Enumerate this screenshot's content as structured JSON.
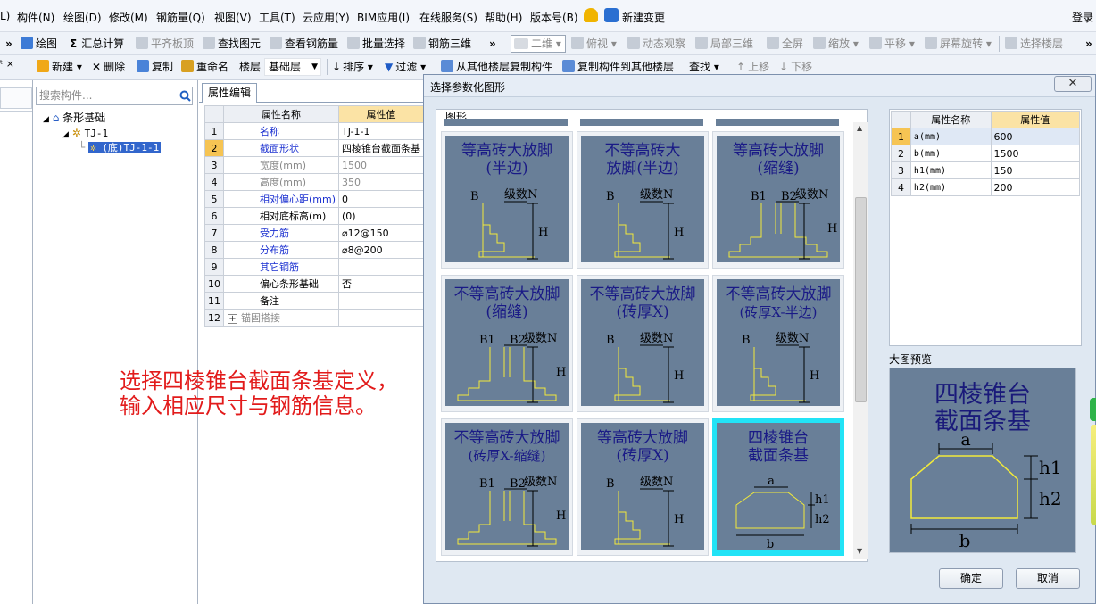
{
  "menubar": {
    "items": [
      "L)",
      "构件(N)",
      "绘图(D)",
      "修改(M)",
      "钢筋量(Q)",
      "视图(V)",
      "工具(T)",
      "云应用(Y)",
      "BIM应用(I)",
      "在线服务(S)",
      "帮助(H)",
      "版本号(B)",
      "新建变更"
    ],
    "login": "登录"
  },
  "toolbar1": {
    "items": [
      "绘图",
      "汇总计算",
      "平齐板顶",
      "查找图元",
      "查看钢筋量",
      "批量选择",
      "钢筋三维",
      "二维",
      "俯视",
      "动态观察",
      "局部三维",
      "全屏",
      "缩放",
      "平移",
      "屏幕旋转",
      "选择楼层"
    ]
  },
  "toolbar2": {
    "items": [
      "新建",
      "删除",
      "复制",
      "重命名",
      "楼层",
      "基础层",
      "排序",
      "过滤",
      "从其他楼层复制构件",
      "复制构件到其他楼层",
      "查找",
      "上移",
      "下移"
    ]
  },
  "tree": {
    "search_placeholder": "搜索构件...",
    "root": "条形基础",
    "child": "TJ-1",
    "leaf": "(底)TJ-1-1"
  },
  "properties": {
    "tab": "属性编辑",
    "col_name": "属性名称",
    "col_value": "属性值",
    "rows": [
      {
        "n": "1",
        "name": "名称",
        "value": "TJ-1-1"
      },
      {
        "n": "2",
        "name": "截面形状",
        "value": "四棱锥台截面条基"
      },
      {
        "n": "3",
        "name": "宽度(mm)",
        "value": "1500"
      },
      {
        "n": "4",
        "name": "高度(mm)",
        "value": "350"
      },
      {
        "n": "5",
        "name": "相对偏心距(mm)",
        "value": "0"
      },
      {
        "n": "6",
        "name": "相对底标高(m)",
        "value": "(0)"
      },
      {
        "n": "7",
        "name": "受力筋",
        "value": "⌀12@150"
      },
      {
        "n": "8",
        "name": "分布筋",
        "value": "⌀8@200"
      },
      {
        "n": "9",
        "name": "其它钢筋",
        "value": ""
      },
      {
        "n": "10",
        "name": "偏心条形基础",
        "value": "否"
      },
      {
        "n": "11",
        "name": "备注",
        "value": ""
      },
      {
        "n": "12",
        "name": "锚固搭接",
        "value": ""
      }
    ]
  },
  "annotation": {
    "line1": "选择四棱锥台截面条基定义，",
    "line2": "输入相应尺寸与钢筋信息。"
  },
  "dialog": {
    "title": "选择参数化图形",
    "close": "✕",
    "gallery_label": "图形",
    "shapes": [
      {
        "title1": "等高砖大放脚",
        "title2": "(半边)",
        "labels": [
          "B",
          "级数N",
          "H"
        ]
      },
      {
        "title1": "不等高砖大",
        "title2": "放脚(半边)",
        "labels": [
          "B",
          "级数N",
          "H"
        ]
      },
      {
        "title1": "等高砖大放脚",
        "title2": "(缩缝)",
        "labels": [
          "B1",
          "B2",
          "级数N",
          "H"
        ]
      },
      {
        "title1": "不等高砖大放脚",
        "title2": "(缩缝)",
        "labels": [
          "B1",
          "B2",
          "级数N",
          "H"
        ]
      },
      {
        "title1": "不等高砖大放脚",
        "title2": "(砖厚X)",
        "labels": [
          "B",
          "级数N",
          "H"
        ]
      },
      {
        "title1": "不等高砖大放脚",
        "title2": "(砖厚X-半边)",
        "labels": [
          "B",
          "级数N",
          "H"
        ]
      },
      {
        "title1": "不等高砖大放脚",
        "title2": "(砖厚X-缩缝)",
        "labels": [
          "B1",
          "B2",
          "级数N",
          "H"
        ]
      },
      {
        "title1": "等高砖大放脚",
        "title2": "(砖厚X)",
        "labels": [
          "B",
          "级数N",
          "H"
        ]
      },
      {
        "title1": "四棱锥台",
        "title2": "截面条基",
        "labels": [
          "a",
          "h1",
          "h2",
          "b"
        ]
      }
    ],
    "params": {
      "col_name": "属性名称",
      "col_value": "属性值",
      "rows": [
        {
          "n": "1",
          "name": "a(mm)",
          "value": "600"
        },
        {
          "n": "2",
          "name": "b(mm)",
          "value": "1500"
        },
        {
          "n": "3",
          "name": "h1(mm)",
          "value": "150"
        },
        {
          "n": "4",
          "name": "h2(mm)",
          "value": "200"
        }
      ]
    },
    "preview_label": "大图预览",
    "preview": {
      "title1": "四棱锥台",
      "title2": "截面条基",
      "a": "a",
      "b": "b",
      "h1": "h1",
      "h2": "h2"
    },
    "ok": "确定",
    "cancel": "取消"
  }
}
